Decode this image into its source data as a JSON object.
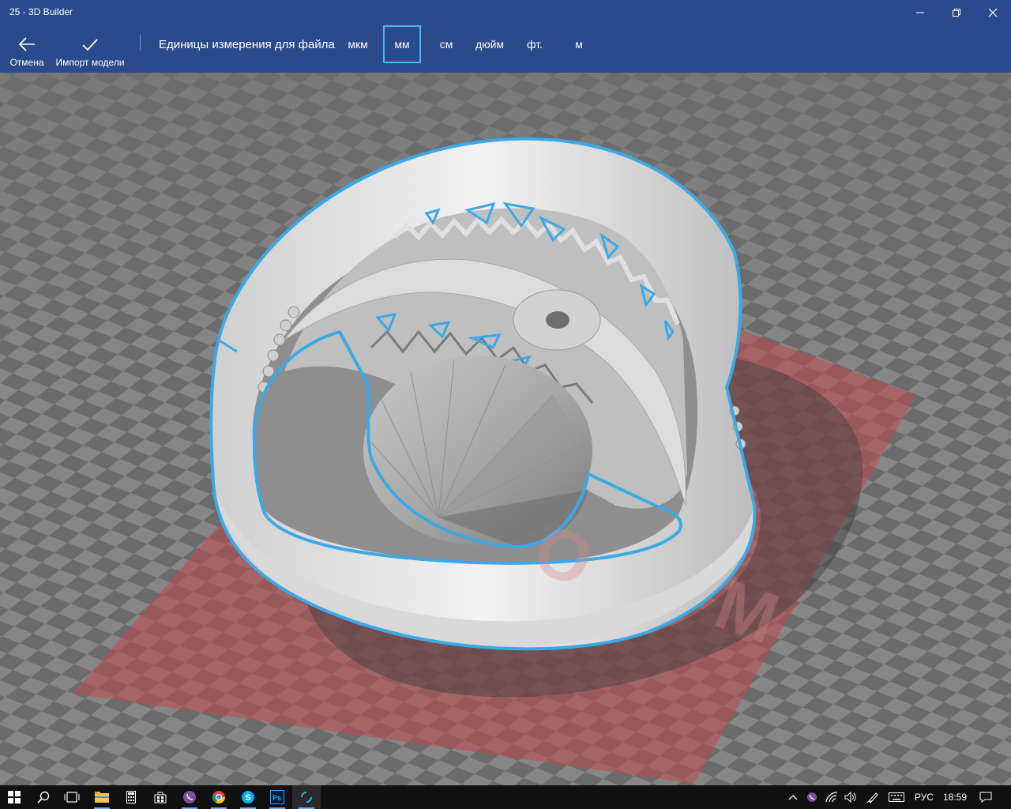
{
  "window": {
    "title": "25 - 3D Builder"
  },
  "toolbar": {
    "cancel_label": "Отмена",
    "import_label": "Импорт модели",
    "units_label": "Единицы измерения для файла",
    "units": [
      {
        "label": "мкм",
        "selected": false
      },
      {
        "label": "мм",
        "selected": true
      },
      {
        "label": "см",
        "selected": false
      },
      {
        "label": "дюйм",
        "selected": false
      },
      {
        "label": "фт.",
        "selected": false
      },
      {
        "label": "м",
        "selected": false
      }
    ]
  },
  "colors": {
    "titlebar_bg": "#2b4a8c",
    "selection_outline": "#3aa9e6",
    "selected_unit_border": "#4fb2f3",
    "grid_dark": "#6a6a6a",
    "grid_light": "#8a8a8a",
    "platform_red": "#b0464a",
    "taskbar_bg": "#101010"
  },
  "taskbar": {
    "icons": [
      "windows-start-icon",
      "search-icon",
      "task-view-icon",
      "file-explorer-icon",
      "calculator-icon",
      "store-icon",
      "viber-icon",
      "chrome-icon",
      "skype-icon",
      "photoshop-icon",
      "3d-builder-icon"
    ],
    "tray_icons": [
      "chevron-up-icon",
      "viber-tray-icon",
      "wifi-icon",
      "volume-icon",
      "pen-icon",
      "keyboard-icon",
      "notifications-icon"
    ],
    "language": "РУС",
    "time": "18:59"
  }
}
